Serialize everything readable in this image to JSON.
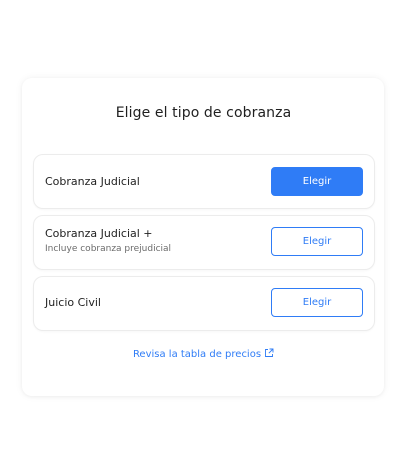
{
  "dialog": {
    "title": "Elige el tipo de cobranza"
  },
  "options": [
    {
      "label": "Cobranza Judicial",
      "subtitle": "",
      "button": "Elegir",
      "primary": true
    },
    {
      "label": "Cobranza Judicial +",
      "subtitle": "Incluye cobranza prejudicial",
      "button": "Elegir",
      "primary": false
    },
    {
      "label": "Juicio Civil",
      "subtitle": "",
      "button": "Elegir",
      "primary": false
    }
  ],
  "footer": {
    "link_text": "Revisa la tabla de precios",
    "link_icon": "external-link-icon"
  },
  "colors": {
    "accent": "#2f7cf6",
    "text": "#1f1f1f",
    "muted": "#6b6b6b"
  }
}
